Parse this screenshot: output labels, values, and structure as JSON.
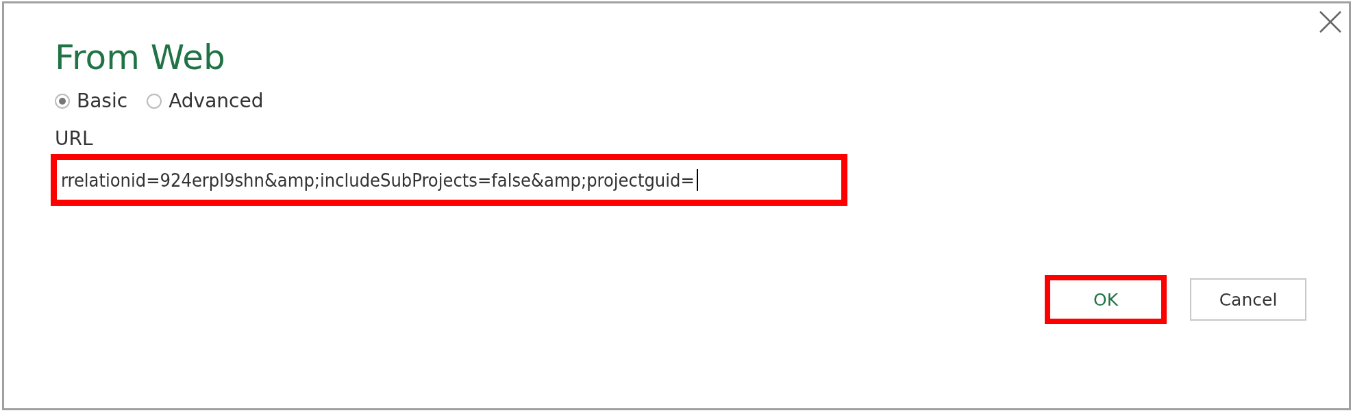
{
  "dialog": {
    "title": "From Web"
  },
  "modes": [
    {
      "label": "Basic",
      "selected": true
    },
    {
      "label": "Advanced",
      "selected": false
    }
  ],
  "url_field": {
    "label": "URL",
    "value": "rrelationid=924erpl9shn&amp;includeSubProjects=false&amp;projectguid=",
    "highlighted": true
  },
  "buttons": [
    {
      "label": "OK",
      "kind": "primary",
      "highlighted": true
    },
    {
      "label": "Cancel",
      "kind": "secondary",
      "highlighted": false
    }
  ]
}
